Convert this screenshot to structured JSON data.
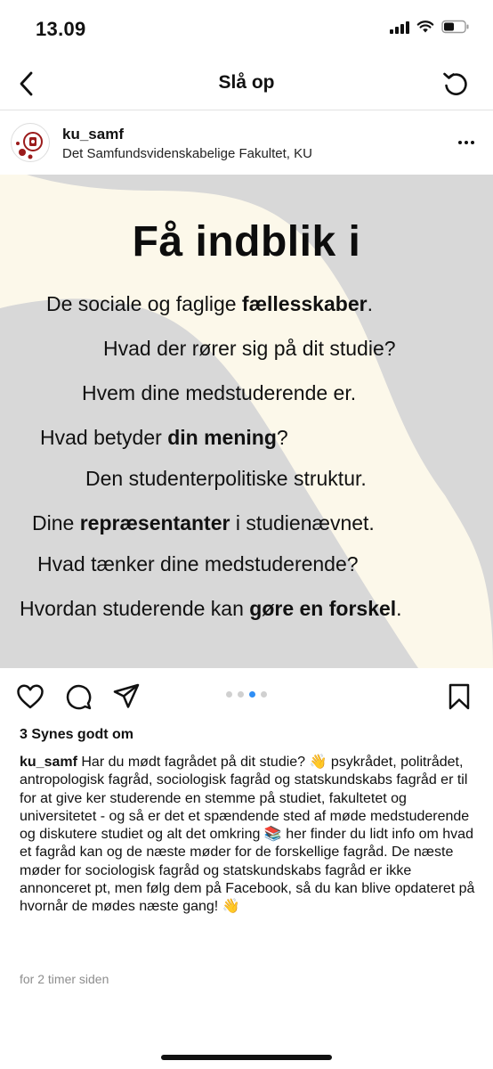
{
  "status_bar": {
    "time": "13.09"
  },
  "nav": {
    "title": "Slå op"
  },
  "post": {
    "username": "ku_samf",
    "subtitle": "Det Samfundsvidenskabelige Fakultet, KU",
    "image": {
      "heading": "Få indblik i",
      "lines": [
        {
          "pre": "De sociale og faglige ",
          "bold": "fællesskaber",
          "post": "."
        },
        {
          "pre": "Hvad der rører sig på dit studie?",
          "bold": "",
          "post": ""
        },
        {
          "pre": "Hvem dine medstuderende er.",
          "bold": "",
          "post": ""
        },
        {
          "pre": "Hvad betyder ",
          "bold": "din mening",
          "post": "?"
        },
        {
          "pre": "Den studenterpolitiske struktur.",
          "bold": "",
          "post": ""
        },
        {
          "pre": "Dine ",
          "bold": "repræsentanter",
          "post": " i studienævnet."
        },
        {
          "pre": "Hvad tænker dine medstuderende?",
          "bold": "",
          "post": ""
        },
        {
          "pre": "Hvordan studerende kan ",
          "bold": "gøre en forskel",
          "post": "."
        }
      ],
      "colors": {
        "background": "#fcf8ea",
        "shape": "#d8d8d8"
      }
    },
    "carousel": {
      "total": 4,
      "active_index": 2,
      "active_color": "#2f8ef5"
    },
    "likes": "3 Synes godt om",
    "caption": {
      "author": "ku_samf",
      "text": " Har du mødt fagrådet på dit studie? 👋 psykrådet, politrådet, antropologisk fagråd, sociologisk fagråd og statskundskabs fagråd er til for at give ker studerende en stemme på studiet, fakultetet og universitetet - og så er det et spændende sted af møde medstuderende og diskutere studiet og alt det omkring 📚 her finder du lidt info om hvad et fagråd kan og de næste møder for de forskellige fagråd. De næste møder for sociologisk fagråd og statskundskabs fagråd er ikke annonceret pt, men følg dem på Facebook, så du kan blive opdateret på hvornår de mødes næste gang! 👋"
    },
    "timestamp": "for 2 timer siden"
  },
  "icons": {
    "back": "chevron-left-icon",
    "refresh": "refresh-icon",
    "more": "more-options-icon",
    "like": "heart-icon",
    "comment": "comment-icon",
    "share": "send-icon",
    "save": "bookmark-icon"
  }
}
